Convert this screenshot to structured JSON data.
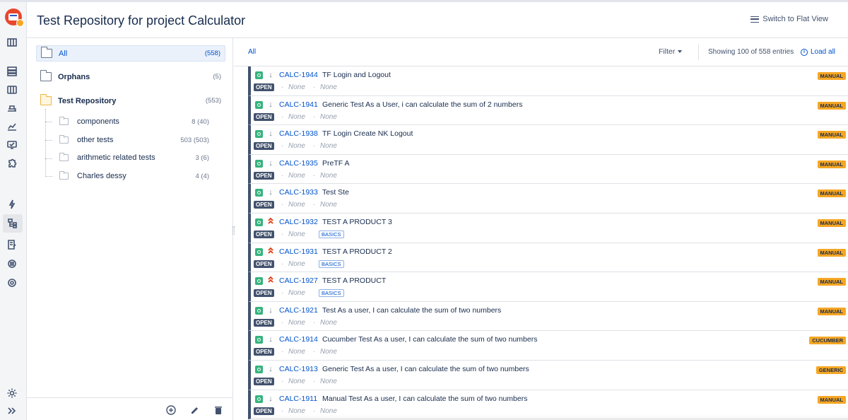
{
  "app": {
    "page_title": "Test Repository for project Calculator",
    "switch_view_label": "Switch to Flat View"
  },
  "sidebar": {
    "icons": [
      "app-logo",
      "board-icon",
      "backlog-icon",
      "columns-icon",
      "releases-icon",
      "reports-icon",
      "test-board-icon",
      "add-ons-icon",
      "lightning-icon",
      "test-repository-icon",
      "test-plans-icon",
      "test-runs-icon",
      "components-icon",
      "settings-icon",
      "expand-icon"
    ]
  },
  "tree": {
    "all": {
      "label": "All",
      "count": "(558)"
    },
    "orphans": {
      "label": "Orphans",
      "count": "(5)"
    },
    "repository": {
      "label": "Test Repository",
      "count": "(553)"
    },
    "children": [
      {
        "label": "components",
        "count": "8 (40)"
      },
      {
        "label": "other tests",
        "count": "503 (503)"
      },
      {
        "label": "arithmetic related tests",
        "count": "3 (6)"
      },
      {
        "label": "Charles dessy",
        "count": "4 (4)"
      }
    ],
    "footer_icons": [
      "add-folder-icon",
      "edit-icon",
      "delete-icon"
    ]
  },
  "tests_bar": {
    "breadcrumb": "All",
    "filter_label": "Filter",
    "showing_text": "Showing 100 of 558 entries",
    "load_all_label": "Load all"
  },
  "tests": [
    {
      "key": "CALC-1944",
      "summary": "TF Login and Logout",
      "status": "OPEN",
      "priority": "low",
      "field1": "None",
      "field2": "None",
      "label": "",
      "type": "MANUAL"
    },
    {
      "key": "CALC-1941",
      "summary": "Generic Test As a User, i can calculate the sum of 2 numbers",
      "status": "OPEN",
      "priority": "low",
      "field1": "None",
      "field2": "None",
      "label": "",
      "type": "MANUAL"
    },
    {
      "key": "CALC-1938",
      "summary": "TF Login Create NK Logout",
      "status": "OPEN",
      "priority": "low",
      "field1": "None",
      "field2": "None",
      "label": "",
      "type": "MANUAL"
    },
    {
      "key": "CALC-1935",
      "summary": "PreTF A",
      "status": "OPEN",
      "priority": "low",
      "field1": "None",
      "field2": "None",
      "label": "",
      "type": "MANUAL"
    },
    {
      "key": "CALC-1933",
      "summary": "Test Ste",
      "status": "OPEN",
      "priority": "low",
      "field1": "None",
      "field2": "None",
      "label": "",
      "type": "MANUAL"
    },
    {
      "key": "CALC-1932",
      "summary": "TEST A PRODUCT 3",
      "status": "OPEN",
      "priority": "high",
      "field1": "None",
      "field2": "",
      "label": "BASICS",
      "type": "MANUAL"
    },
    {
      "key": "CALC-1931",
      "summary": "TEST A PRODUCT 2",
      "status": "OPEN",
      "priority": "high",
      "field1": "None",
      "field2": "",
      "label": "BASICS",
      "type": "MANUAL"
    },
    {
      "key": "CALC-1927",
      "summary": "TEST A PRODUCT",
      "status": "OPEN",
      "priority": "high",
      "field1": "None",
      "field2": "",
      "label": "BASICS",
      "type": "MANUAL"
    },
    {
      "key": "CALC-1921",
      "summary": "Test As a user, I can calculate the sum of two numbers",
      "status": "OPEN",
      "priority": "low",
      "field1": "None",
      "field2": "None",
      "label": "",
      "type": "MANUAL"
    },
    {
      "key": "CALC-1914",
      "summary": "Cucumber Test As a user, I can calculate the sum of two numbers",
      "status": "OPEN",
      "priority": "low",
      "field1": "None",
      "field2": "None",
      "label": "",
      "type": "CUCUMBER"
    },
    {
      "key": "CALC-1913",
      "summary": "Generic Test As a user, I can calculate the sum of two numbers",
      "status": "OPEN",
      "priority": "low",
      "field1": "None",
      "field2": "None",
      "label": "",
      "type": "GENERIC"
    },
    {
      "key": "CALC-1911",
      "summary": "Manual Test As a user, I can calculate the sum of two numbers",
      "status": "OPEN",
      "priority": "low",
      "field1": "None",
      "field2": "None",
      "label": "",
      "type": "MANUAL"
    }
  ],
  "colors": {
    "link": "#0052cc",
    "badge": "#f5a623",
    "status": "#42526e",
    "priority_high": "#de350b"
  }
}
